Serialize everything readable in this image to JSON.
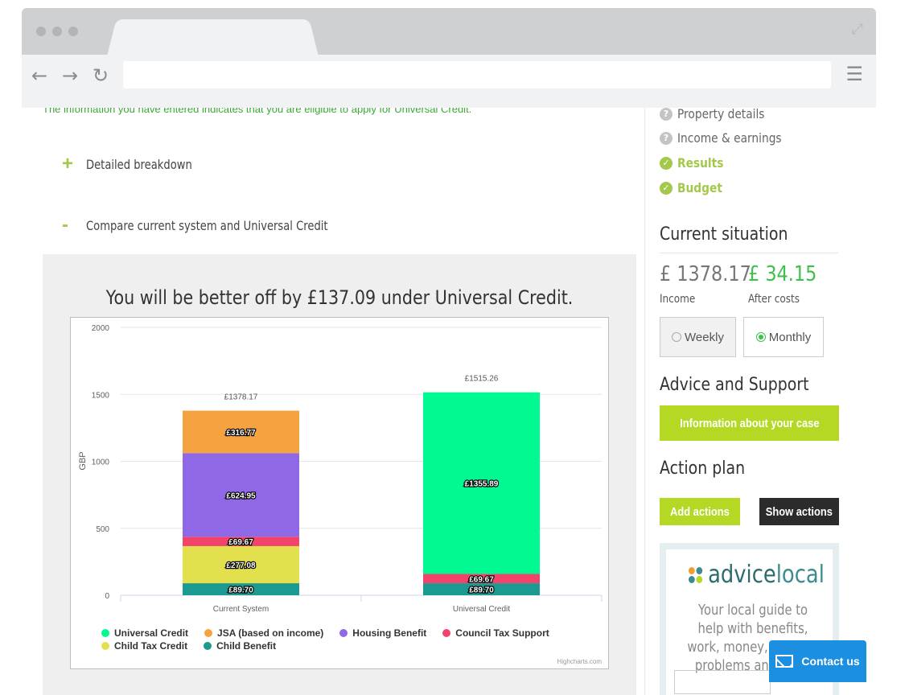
{
  "page": {
    "info_line": "The information you have entered indicates that you are eligible to apply for Universal Credit.",
    "detailed_breakdown_sign": "+",
    "detailed_breakdown_label": "Detailed breakdown",
    "compare_sign": "-",
    "compare_label": "Compare current system and Universal Credit",
    "compare_title": "You will be better off by £137.09 under Universal Credit.",
    "credits": "Highcharts.com"
  },
  "sidebar": {
    "steps": [
      {
        "label": "Property details",
        "state": "pending",
        "icon": "question-icon"
      },
      {
        "label": "Income & earnings",
        "state": "pending",
        "icon": "question-icon"
      },
      {
        "label": "Results",
        "state": "done",
        "icon": "check-icon"
      },
      {
        "label": "Budget",
        "state": "done",
        "icon": "check-icon"
      }
    ],
    "current_situation": "Current situation",
    "income_value": "£ 1378.17",
    "after_costs_value": "£ 34.15",
    "income_label": "Income",
    "after_costs_label": "After costs",
    "weekly_label": "Weekly",
    "monthly_label": "Monthly",
    "selected_period": "Monthly",
    "advice_heading": "Advice and Support",
    "info_button": "Information about your case",
    "action_heading": "Action plan",
    "add_actions": "Add actions",
    "show_actions": "Show actions",
    "advicelocal_a": "advice",
    "advicelocal_b": "local",
    "advicelocal_text": "Your local guide to help with benefits, work, money, housing problems and more",
    "contact_us": "Contact us"
  },
  "colors": {
    "accent_green": "#b5d825",
    "green_text": "#3dc14b",
    "dark_button": "#2b2b2b",
    "contact_blue": "#1d8fe0"
  },
  "chart_data": {
    "type": "bar",
    "stacked": true,
    "title": "You will be better off by £137.09 under Universal Credit.",
    "ylabel": "GBP",
    "ylim": [
      0,
      2000
    ],
    "yticks": [
      "0",
      "500",
      "1000",
      "1500",
      "2000"
    ],
    "categories": [
      "Current System",
      "Universal Credit"
    ],
    "totals": [
      "£1378.17",
      "£1515.26"
    ],
    "legend_position": "bottom",
    "series": [
      {
        "name": "Child Benefit",
        "color": "#1a9a91",
        "values": [
          89.7,
          89.7
        ],
        "labels": [
          "£89.70",
          "£89.70"
        ]
      },
      {
        "name": "Child Tax Credit",
        "color": "#e2e04c",
        "values": [
          277.08,
          0
        ],
        "labels": [
          "£277.08",
          ""
        ]
      },
      {
        "name": "Council Tax Support",
        "color": "#f2436b",
        "values": [
          69.67,
          69.67
        ],
        "labels": [
          "£69.67",
          "£69.67"
        ]
      },
      {
        "name": "Housing Benefit",
        "color": "#8e68e6",
        "values": [
          624.95,
          0
        ],
        "labels": [
          "£624.95",
          ""
        ]
      },
      {
        "name": "JSA (based on income)",
        "color": "#f5a340",
        "values": [
          316.77,
          0
        ],
        "labels": [
          "£316.77",
          ""
        ]
      },
      {
        "name": "Universal Credit",
        "color": "#00fa91",
        "values": [
          0,
          1355.89
        ],
        "labels": [
          "",
          "£1355.89"
        ]
      }
    ],
    "legend_order": [
      "Universal Credit",
      "JSA (based on income)",
      "Housing Benefit",
      "Council Tax Support",
      "Child Tax Credit",
      "Child Benefit"
    ]
  }
}
